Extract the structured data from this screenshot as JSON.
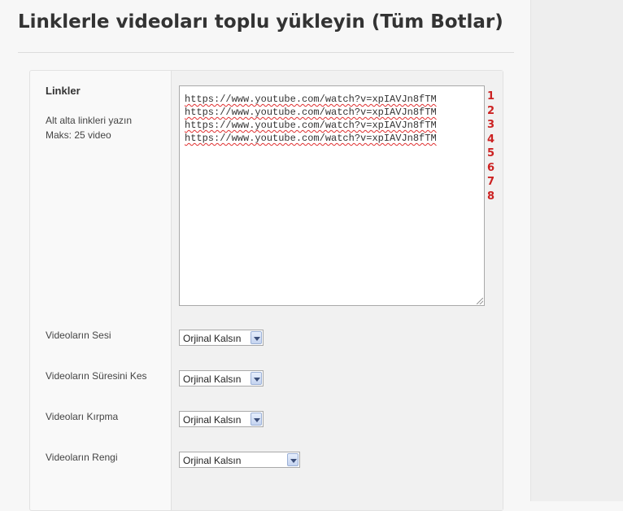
{
  "page": {
    "title": "Linklerle videoları toplu yükleyin (Tüm Botlar)"
  },
  "links_section": {
    "label": "Linkler",
    "help_1": "Alt alta linkleri yazın",
    "help_2": "Maks: 25 video",
    "lines": [
      "https://www.youtube.com/watch?v=xpIAVJn8fTM",
      "https://www.youtube.com/watch?v=xpIAVJn8fTM",
      "https://www.youtube.com/watch?v=xpIAVJn8fTM",
      "https://www.youtube.com/watch?v=xpIAVJn8fTM"
    ],
    "line_numbers": [
      "1",
      "2",
      "3",
      "4",
      "5",
      "6",
      "7",
      "8"
    ],
    "line_number_color": "#cc2222"
  },
  "options": {
    "sound": {
      "label": "Videoların Sesi",
      "value": "Orjinal Kalsın"
    },
    "duration": {
      "label": "Videoların Süresini Kes",
      "value": "Orjinal Kalsın"
    },
    "crop": {
      "label": "Videoları Kırpma",
      "value": "Orjinal Kalsın"
    },
    "color": {
      "label": "Videoların Rengi",
      "value": "Orjinal Kalsın"
    }
  }
}
